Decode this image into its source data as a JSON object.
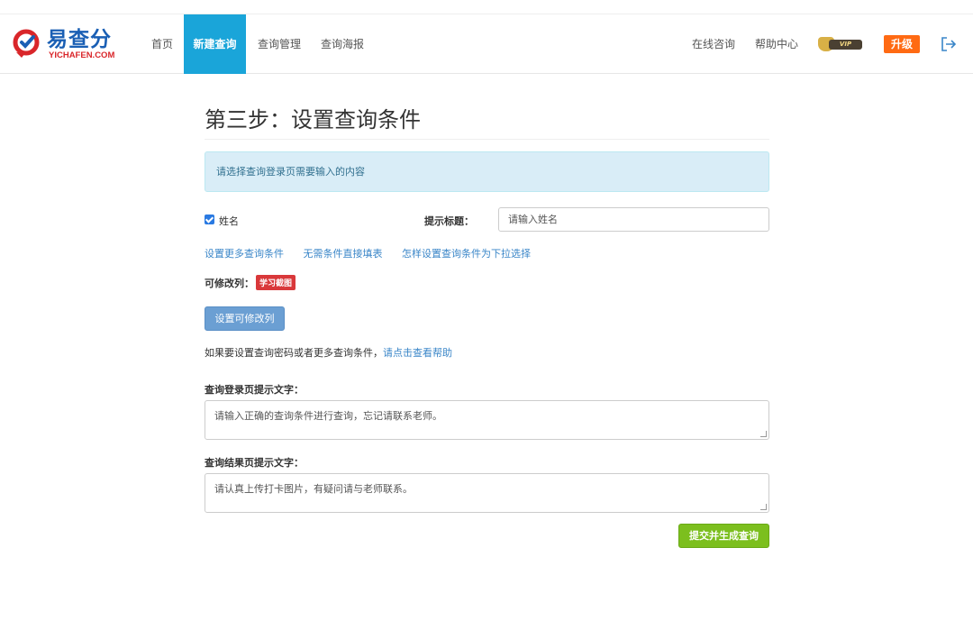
{
  "header": {
    "logo_text": "易查分",
    "logo_sub": "YICHAFEN.COM",
    "nav": [
      "首页",
      "新建查询",
      "查询管理",
      "查询海报"
    ],
    "right_nav": [
      "在线咨询",
      "帮助中心"
    ],
    "vip_label": "VIP",
    "upgrade_label": "升级",
    "active_color": "#1aa5d9"
  },
  "main": {
    "step_title": "第三步：设置查询条件",
    "alert_text": "请选择查询登录页需要输入的内容",
    "condition": {
      "label": "姓名",
      "checked": true
    },
    "tip_title_label": "提示标题：",
    "tip_input_placeholder": "请输入姓名",
    "links": [
      "设置更多查询条件",
      "无需条件直接填表",
      "怎样设置查询条件为下拉选择"
    ],
    "editable_label": "可修改列：",
    "learn_badge": "学习截图",
    "set_editable_button": "设置可修改列",
    "help_text": "如果要设置查询密码或者更多查询条件，",
    "help_link": "请点击查看帮助",
    "login_tip_label": "查询登录页提示文字：",
    "login_tip_value": "请输入正确的查询条件进行查询，忘记请联系老师。",
    "result_tip_label": "查询结果页提示文字：",
    "result_tip_value": "请认真上传打卡图片，有疑问请与老师联系。",
    "submit_button": "提交并生成查询"
  }
}
